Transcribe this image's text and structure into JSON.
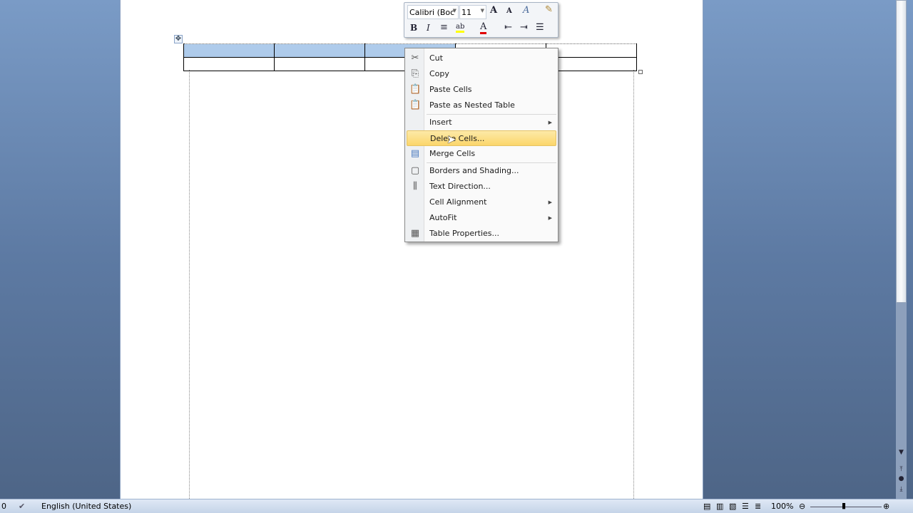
{
  "mini_toolbar": {
    "font": "Calibri (Boc",
    "size": "11",
    "grow_font": "A",
    "shrink_font": "A",
    "styles": "A",
    "bold": "B",
    "italic": "I",
    "center": "≡",
    "highlight": "ab",
    "font_color": "A",
    "decrease_indent": "⇤",
    "increase_indent": "⇥",
    "bullets": "☰",
    "highlight_color": "#ffff00",
    "font_color_value": "#e00000"
  },
  "context_menu": {
    "items": [
      {
        "label": "Cut",
        "icon": "scissors-icon"
      },
      {
        "label": "Copy",
        "icon": "copy-icon"
      },
      {
        "label": "Paste Cells",
        "icon": "paste-icon"
      },
      {
        "label": "Paste as Nested Table",
        "icon": "paste-icon"
      },
      {
        "label": "Insert",
        "submenu": true
      },
      {
        "label": "Delete Cells...",
        "highlighted": true
      },
      {
        "label": "Merge Cells",
        "icon": "merge-cells-icon"
      },
      {
        "label": "Borders and Shading...",
        "icon": "borders-icon"
      },
      {
        "label": "Text Direction...",
        "icon": "text-direction-icon"
      },
      {
        "label": "Cell Alignment",
        "submenu": true
      },
      {
        "label": "AutoFit",
        "submenu": true
      },
      {
        "label": "Table Properties...",
        "icon": "table-properties-icon"
      }
    ]
  },
  "status_bar": {
    "page_count": "0",
    "language": "English (United States)",
    "zoom": "100%"
  }
}
